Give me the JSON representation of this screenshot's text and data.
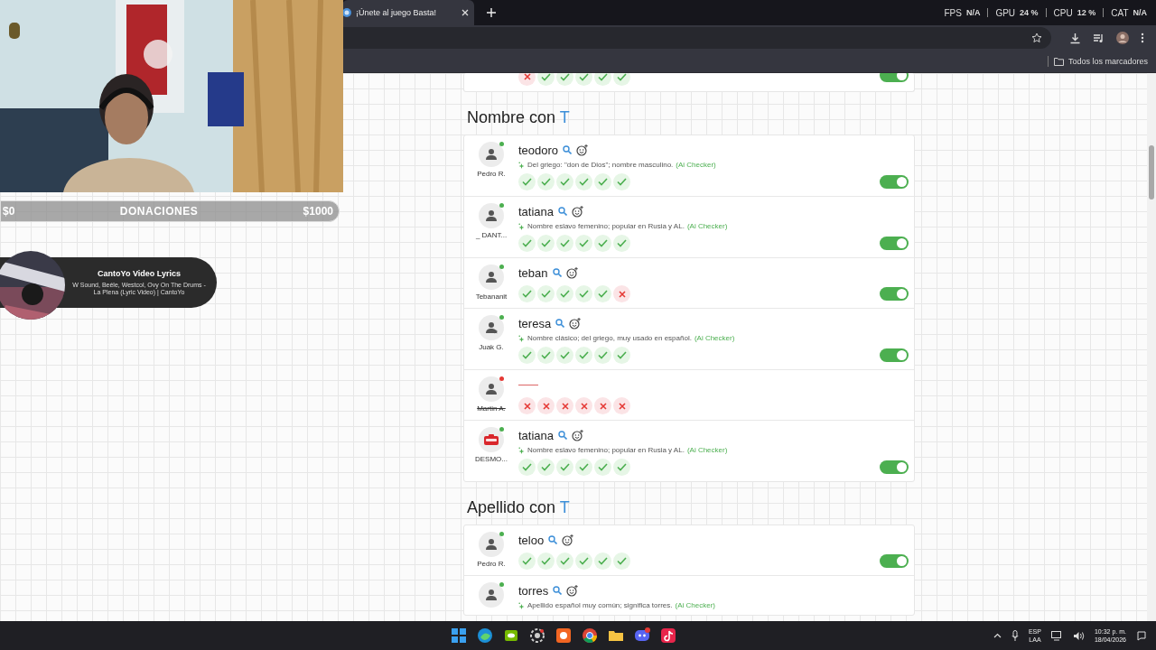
{
  "browser": {
    "tab_title": "¡Únete al juego Basta!",
    "stats": [
      {
        "label": "FPS",
        "value": "N/A"
      },
      {
        "label": "GPU",
        "value": "24 %"
      },
      {
        "label": "CPU",
        "value": "12 %"
      },
      {
        "label": "CAT",
        "value": "N/A"
      }
    ],
    "bookmarks": "Todos los marcadores"
  },
  "overlay": {
    "donations": {
      "min": "$0",
      "title": "DONACIONES",
      "max": "$1000",
      "level": 0
    },
    "now_playing": {
      "title": "CantoYo Video Lyrics",
      "subtitle": "W Sound, Beéle, Westcol, Ovy On The Drums - La Plena (Lyric Video) | CantoYo"
    }
  },
  "previous_card": {
    "marks": [
      false,
      true,
      true,
      true,
      true,
      true
    ],
    "approved": true
  },
  "sections": [
    {
      "title": "Nombre con ",
      "letter": "T",
      "entries": [
        {
          "player": "Pedro R.",
          "online": true,
          "avatar": {
            "kind": "person"
          },
          "word": "teodoro",
          "note": "Del griego: \"don de Dios\"; nombre masculino.",
          "note_source": "(Ai Checker)",
          "marks": [
            true,
            true,
            true,
            true,
            true,
            true
          ],
          "approved": true
        },
        {
          "player": "_ DANT...",
          "online": true,
          "avatar": {
            "kind": "person"
          },
          "word": "tatiana",
          "note": "Nombre eslavo femenino; popular en Rusia y AL.",
          "note_source": "(Ai Checker)",
          "marks": [
            true,
            true,
            true,
            true,
            true,
            true
          ],
          "approved": true
        },
        {
          "player": "Tebananit",
          "online": true,
          "avatar": {
            "kind": "person"
          },
          "word": "teban",
          "marks": [
            true,
            true,
            true,
            true,
            true,
            false
          ],
          "approved": true
        },
        {
          "player": "Juak G.",
          "online": true,
          "avatar": {
            "kind": "person-star"
          },
          "word": "teresa",
          "note": "Nombre clásico; del griego, muy usado en español.",
          "note_source": "(Ai Checker)",
          "marks": [
            true,
            true,
            true,
            true,
            true,
            true
          ],
          "approved": true
        },
        {
          "player": "Martin A.",
          "online": false,
          "struck": true,
          "avatar": {
            "kind": "person"
          },
          "marks": [
            false,
            false,
            false,
            false,
            false,
            false
          ]
        },
        {
          "player": "DESMO...",
          "online": true,
          "avatar": {
            "kind": "stop"
          },
          "word": "tatiana",
          "note": "Nombre eslavo femenino; popular en Rusia y AL.",
          "note_source": "(Ai Checker)",
          "marks": [
            true,
            true,
            true,
            true,
            true,
            true
          ],
          "approved": true
        }
      ]
    },
    {
      "title": "Apellido con ",
      "letter": "T",
      "entries": [
        {
          "player": "Pedro R.",
          "online": true,
          "avatar": {
            "kind": "person"
          },
          "word": "teloo",
          "marks": [
            true,
            true,
            true,
            true,
            true,
            true
          ],
          "approved": true
        },
        {
          "online": true,
          "avatar": {
            "kind": "person"
          },
          "word": "torres",
          "note": "Apellido español muy común; significa torres.",
          "note_source": "(Ai Checker)"
        }
      ]
    }
  ],
  "taskbar": {
    "language": "ESP",
    "layout": "LAA",
    "time": "10:32 p. m.",
    "date": "18/04/2026"
  }
}
